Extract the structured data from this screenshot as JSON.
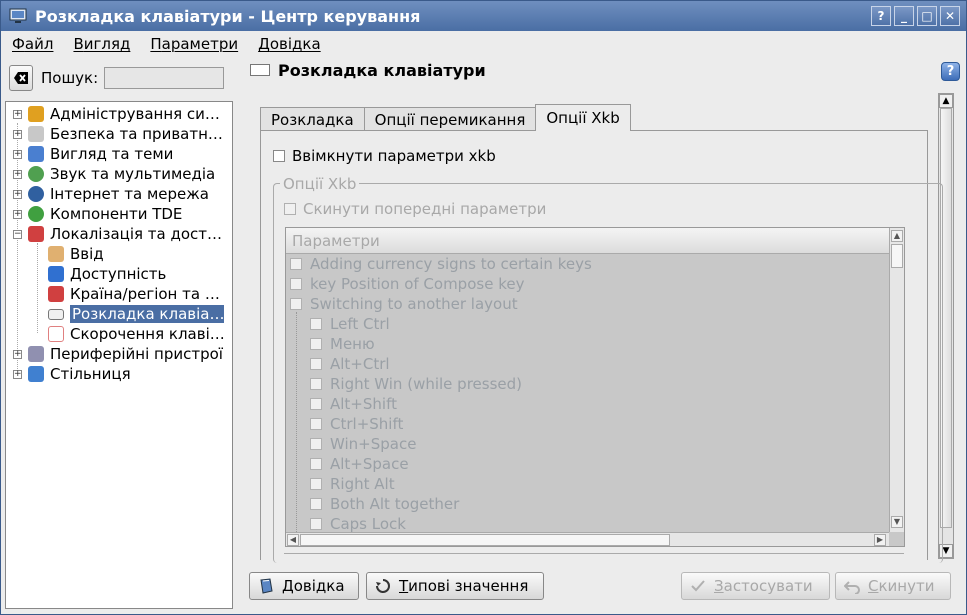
{
  "window": {
    "title": "Розкладка клавіатури - Центр керування",
    "controls": [
      "?",
      "_",
      "□",
      "✕"
    ]
  },
  "menubar": {
    "items": [
      {
        "u": "Ф",
        "rest": "айл"
      },
      {
        "u": "В",
        "rest": "игляд"
      },
      {
        "u": "П",
        "rest": "араметри"
      },
      {
        "u": "Д",
        "rest": "овідка"
      }
    ]
  },
  "search": {
    "label": "Пошук:",
    "value": ""
  },
  "tree": {
    "items": [
      {
        "label": "Адміністрування си…",
        "expander": "+",
        "color": "#e0a020"
      },
      {
        "label": "Безпека та приватн…",
        "expander": "+",
        "color": "#c8c8c8"
      },
      {
        "label": "Вигляд та теми",
        "expander": "+",
        "color": "#4a7fd0"
      },
      {
        "label": "Звук та мультимедіа",
        "expander": "+",
        "color": "#50a050"
      },
      {
        "label": "Інтернет та мережа",
        "expander": "+",
        "color": "#3060a0"
      },
      {
        "label": "Компоненти TDE",
        "expander": "+",
        "color": "#40a040"
      },
      {
        "label": "Локалізація та дост…",
        "expander": "−",
        "color": "#d04040"
      },
      {
        "label": "Ввід",
        "child": true,
        "color": "#e0b070"
      },
      {
        "label": "Доступність",
        "child": true,
        "color": "#3070d0"
      },
      {
        "label": "Країна/регіон та …",
        "child": true,
        "color": "#d04040"
      },
      {
        "label": "Розкладка клавіа…",
        "child": true,
        "selected": true,
        "color": "#f0f0f0"
      },
      {
        "label": "Скорочення клаві…",
        "child": true,
        "color": "#e08080"
      },
      {
        "label": "Периферійні пристрої",
        "expander": "+",
        "color": "#9090b0"
      },
      {
        "label": "Стільниця",
        "expander": "+",
        "color": "#4080d0"
      }
    ]
  },
  "main": {
    "title": "Розкладка клавіатури",
    "help": "?",
    "tabs": [
      "Розкладка",
      "Опції перемикання",
      "Опції Xkb"
    ],
    "enable_xkb": "Ввімкнути параметри xkb",
    "group_title": "Опції Xkb",
    "reset_label": "Скинути попередні параметри",
    "list_header": "Параметри",
    "options": [
      {
        "label": "Adding currency signs to certain keys",
        "level": 0
      },
      {
        "label": "key Position of Compose key",
        "level": 0
      },
      {
        "label": "Switching to another layout",
        "level": 0
      },
      {
        "label": "Left Ctrl",
        "level": 1
      },
      {
        "label": "Меню",
        "level": 1
      },
      {
        "label": "Alt+Ctrl",
        "level": 1
      },
      {
        "label": "Right Win (while pressed)",
        "level": 1
      },
      {
        "label": "Alt+Shift",
        "level": 1
      },
      {
        "label": "Ctrl+Shift",
        "level": 1
      },
      {
        "label": "Win+Space",
        "level": 1
      },
      {
        "label": "Alt+Space",
        "level": 1
      },
      {
        "label": "Right Alt",
        "level": 1
      },
      {
        "label": "Both Alt together",
        "level": 1
      },
      {
        "label": "Caps Lock",
        "level": 1
      }
    ]
  },
  "buttons": {
    "help": {
      "u": "Д",
      "rest": "овідка"
    },
    "defaults": {
      "u": "Т",
      "rest": "ипові значення"
    },
    "apply": {
      "u": "З",
      "rest": "астосувати"
    },
    "reset": {
      "u": "С",
      "rest": "кинути"
    }
  }
}
